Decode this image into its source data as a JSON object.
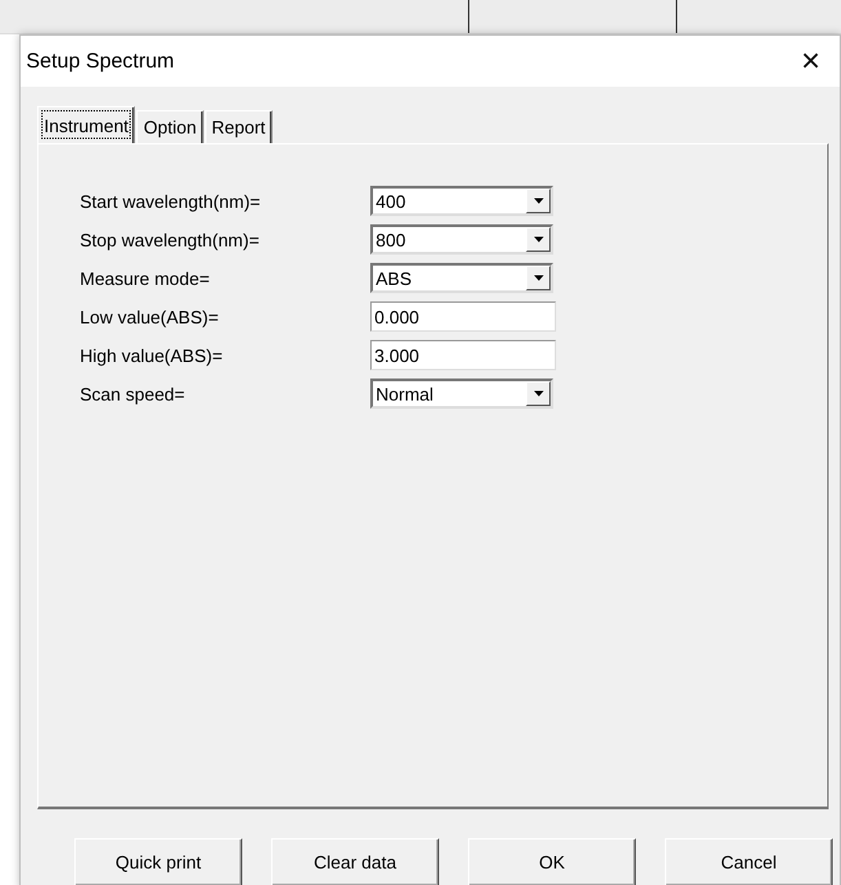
{
  "window": {
    "title": "Setup Spectrum",
    "close": "×"
  },
  "tabs": [
    {
      "label": "Instrument",
      "selected": true
    },
    {
      "label": "Option",
      "selected": false
    },
    {
      "label": "Report",
      "selected": false
    }
  ],
  "fields": [
    {
      "label": "Start wavelength(nm)=",
      "kind": "combo",
      "value": "400"
    },
    {
      "label": "Stop wavelength(nm)=",
      "kind": "combo",
      "value": "800"
    },
    {
      "label": "Measure mode=",
      "kind": "combo",
      "value": "ABS"
    },
    {
      "label": "Low value(ABS)=",
      "kind": "text",
      "value": "0.000"
    },
    {
      "label": "High value(ABS)=",
      "kind": "text",
      "value": "3.000"
    },
    {
      "label": "Scan speed=",
      "kind": "combo",
      "value": "Normal"
    }
  ],
  "buttons": [
    "Quick print",
    "Clear data",
    "OK",
    "Cancel"
  ]
}
